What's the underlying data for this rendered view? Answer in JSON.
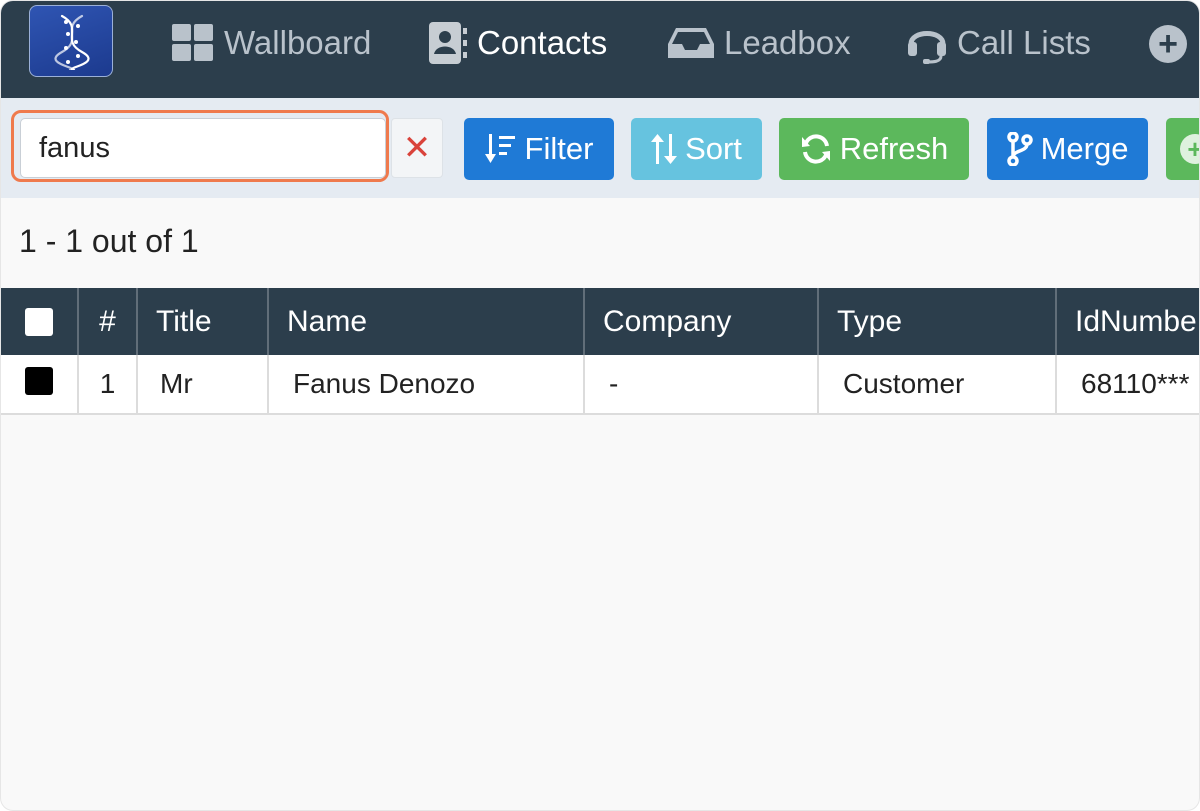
{
  "nav": {
    "items": [
      {
        "label": "Wallboard",
        "icon": "grid-icon"
      },
      {
        "label": "Contacts",
        "icon": "contact-card-icon",
        "active": true
      },
      {
        "label": "Leadbox",
        "icon": "inbox-icon"
      },
      {
        "label": "Call Lists",
        "icon": "headset-icon"
      }
    ],
    "more_icon": "plus-circle-icon"
  },
  "search": {
    "value": "fanus"
  },
  "toolbar": {
    "filter_label": "Filter",
    "sort_label": "Sort",
    "refresh_label": "Refresh",
    "merge_label": "Merge"
  },
  "results": {
    "count_text": "1 - 1 out of 1"
  },
  "table": {
    "headers": [
      "#",
      "Title",
      "Name",
      "Company",
      "Type",
      "IdNumbe"
    ],
    "rows": [
      {
        "num": "1",
        "title": "Mr",
        "name": "Fanus Denozo",
        "company": "-",
        "type": "Customer",
        "id_number": "68110***"
      }
    ]
  },
  "colors": {
    "navbar": "#2c3e4c",
    "primary": "#1f7ad6",
    "info": "#66c3df",
    "success": "#5cb85c",
    "danger": "#d9433b",
    "highlight": "#ef7a4d"
  }
}
